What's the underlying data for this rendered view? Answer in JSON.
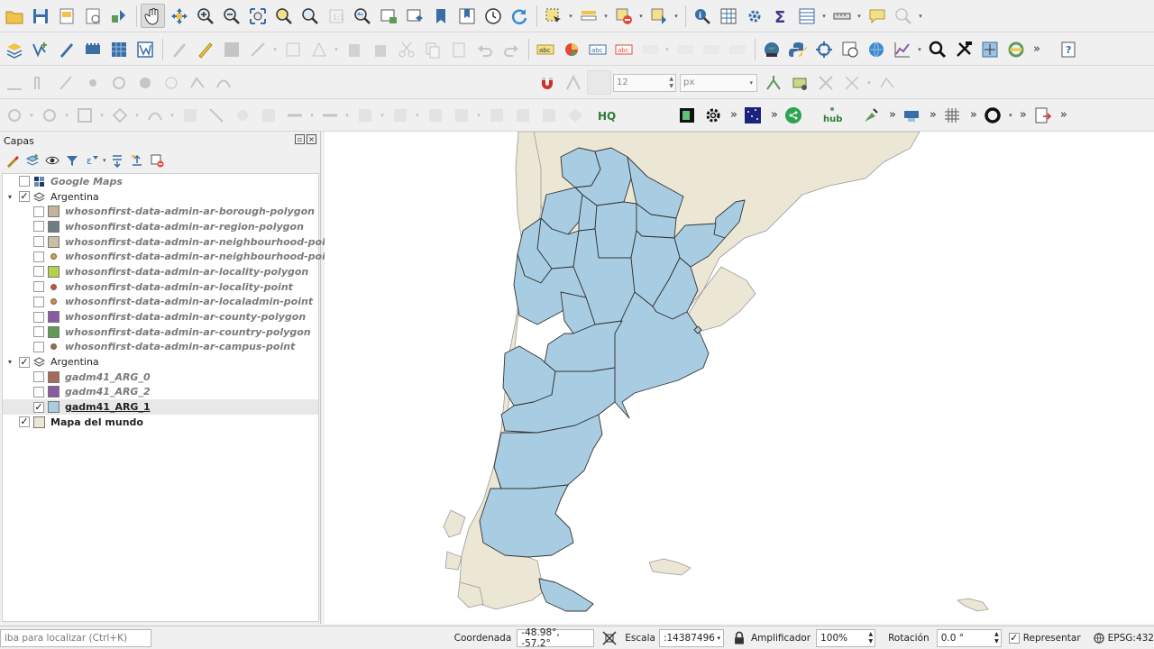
{
  "layers_panel": {
    "title": "Capas",
    "tree": [
      {
        "label": "Google Maps",
        "style": "grey",
        "checked": false,
        "indent": 1,
        "type": "raster"
      },
      {
        "label": "Argentina",
        "style": "normal",
        "checked": true,
        "indent": 0,
        "type": "group",
        "expanded": true
      },
      {
        "label": "whosonfirst-data-admin-ar-borough-polygon",
        "style": "grey",
        "checked": false,
        "indent": 2,
        "symbol": "#c2b49a"
      },
      {
        "label": "whosonfirst-data-admin-ar-region-polygon",
        "style": "grey",
        "checked": false,
        "indent": 2,
        "symbol": "#6f7d85"
      },
      {
        "label": "whosonfirst-data-admin-ar-neighbourhood-polygon",
        "style": "grey",
        "checked": false,
        "indent": 2,
        "symbol": "#c9bfa6"
      },
      {
        "label": "whosonfirst-data-admin-ar-neighbourhood-point",
        "style": "grey",
        "checked": false,
        "indent": 2,
        "point": "#e0a030"
      },
      {
        "label": "whosonfirst-data-admin-ar-locality-polygon",
        "style": "grey",
        "checked": false,
        "indent": 2,
        "symbol": "#b7d04a"
      },
      {
        "label": "whosonfirst-data-admin-ar-locality-point",
        "style": "grey",
        "checked": false,
        "indent": 2,
        "point": "#d04a3a"
      },
      {
        "label": "whosonfirst-data-admin-ar-localadmin-point",
        "style": "grey",
        "checked": false,
        "indent": 2,
        "point": "#e08a30"
      },
      {
        "label": "whosonfirst-data-admin-ar-county-polygon",
        "style": "grey",
        "checked": false,
        "indent": 2,
        "symbol": "#8a5aa8"
      },
      {
        "label": "whosonfirst-data-admin-ar-country-polygon",
        "style": "grey",
        "checked": false,
        "indent": 2,
        "symbol": "#5e9a5a"
      },
      {
        "label": "whosonfirst-data-admin-ar-campus-point",
        "style": "grey",
        "checked": false,
        "indent": 2,
        "point": "#a0684a"
      },
      {
        "label": "Argentina",
        "style": "normal",
        "checked": true,
        "indent": 0,
        "type": "group",
        "expanded": true
      },
      {
        "label": "gadm41_ARG_0",
        "style": "grey",
        "checked": false,
        "indent": 2,
        "symbol": "#a86a5a"
      },
      {
        "label": "gadm41_ARG_2",
        "style": "grey",
        "checked": false,
        "indent": 2,
        "symbol": "#8c5aa0"
      },
      {
        "label": "gadm41_ARG_1",
        "style": "underline",
        "checked": true,
        "indent": 2,
        "symbol": "#a8cde2",
        "selected": true
      },
      {
        "label": "Mapa del mundo",
        "style": "bold",
        "checked": true,
        "indent": 1,
        "symbol": "#ece6d4"
      }
    ]
  },
  "toolbar": {
    "snap_value": "12",
    "snap_unit": "px"
  },
  "status": {
    "locator_placeholder": "iba para localizar (Ctrl+K)",
    "coord_label": "Coordenada",
    "coord_value": "-48.98°, -57.2°",
    "scale_label": "Escala",
    "scale_value": ":14387496",
    "magnifier_label": "Amplificador",
    "magnifier_value": "100%",
    "rotation_label": "Rotación",
    "rotation_value": "0.0 °",
    "render_label": "Representar",
    "crs_label": "EPSG:432"
  },
  "colors": {
    "land": "#ece6d4",
    "argentina": "#a8cde2",
    "border": "#3a3a3a"
  }
}
